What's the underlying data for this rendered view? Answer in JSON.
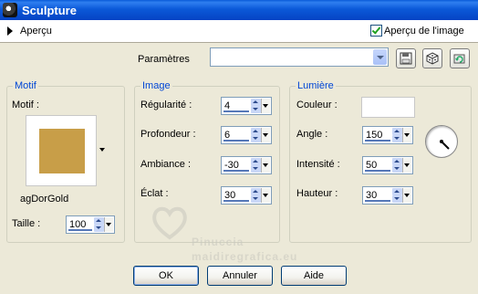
{
  "window": {
    "title": "Sculpture"
  },
  "topbar": {
    "preview_label": "Aperçu",
    "preview_image_label": "Aperçu de l'image",
    "preview_image_checked": true
  },
  "params": {
    "label": "Paramètres",
    "value": ""
  },
  "motif_group": {
    "legend": "Motif",
    "motif_label": "Motif :",
    "swatch_color": "#c89e48",
    "swatch_name": "agDorGold",
    "size_label": "Taille :",
    "size_value": "100"
  },
  "image_group": {
    "legend": "Image",
    "fields": [
      {
        "label": "Régularité :",
        "value": "4"
      },
      {
        "label": "Profondeur :",
        "value": "6"
      },
      {
        "label": "Ambiance :",
        "value": "-30"
      },
      {
        "label": "Éclat :",
        "value": "30"
      }
    ]
  },
  "light_group": {
    "legend": "Lumière",
    "color_label": "Couleur :",
    "color_value": "#ffffff",
    "angle_label": "Angle :",
    "angle_value": "150",
    "intensity_label": "Intensité :",
    "intensity_value": "50",
    "height_label": "Hauteur :",
    "height_value": "30"
  },
  "watermark": {
    "line1": "Pinuccia",
    "line2": "maidiregrafica.eu"
  },
  "buttons": {
    "ok": "OK",
    "cancel": "Annuler",
    "help": "Aide"
  },
  "colors": {
    "title_bar": "#0a5bd8",
    "accent": "#0046d5",
    "dialog_bg": "#ece9d8"
  }
}
